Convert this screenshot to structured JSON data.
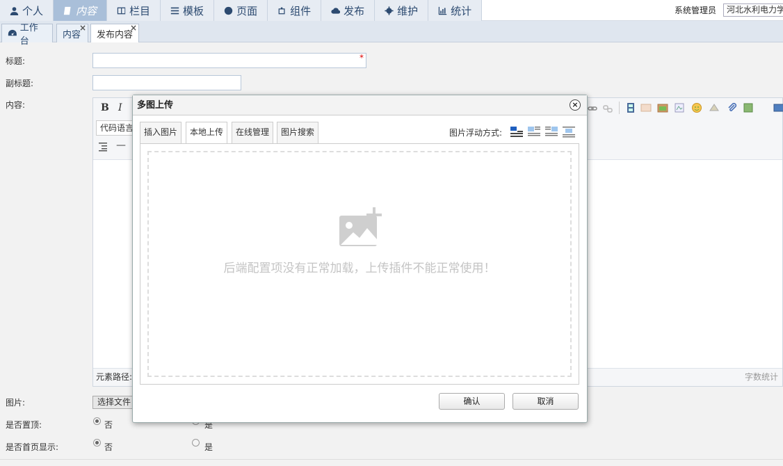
{
  "topnav": {
    "menu": [
      {
        "label": "个人",
        "icon": "person-icon"
      },
      {
        "label": "内容",
        "icon": "book-icon"
      },
      {
        "label": "栏目",
        "icon": "columns-icon"
      },
      {
        "label": "模板",
        "icon": "list-icon"
      },
      {
        "label": "页面",
        "icon": "globe-icon"
      },
      {
        "label": "组件",
        "icon": "puzzle-icon"
      },
      {
        "label": "发布",
        "icon": "cloud-upload-icon"
      },
      {
        "label": "维护",
        "icon": "gear-icon"
      },
      {
        "label": "统计",
        "icon": "bar-chart-icon"
      }
    ],
    "active_index": 1,
    "user_label": "系统管理员",
    "site_value": "河北水利电力学"
  },
  "tabs": [
    {
      "label": "工作台",
      "icon": "dashboard-icon",
      "closable": false
    },
    {
      "label": "内容",
      "closable": true
    },
    {
      "label": "发布内容",
      "closable": true
    }
  ],
  "tab_close_glyph": "×",
  "form": {
    "title_label": "标题:",
    "subtitle_label": "副标题:",
    "content_label": "内容:",
    "image_label": "图片:",
    "top_label": "是否置顶:",
    "home_label": "是否首页显示:",
    "required_mark": "*",
    "choose_file": "选择文件",
    "no_label": "否",
    "yes_label": "是"
  },
  "editor": {
    "bold": "B",
    "italic": "I",
    "code_lang": "代码语言",
    "hr_glyph": "—",
    "element_path": "元素路径:",
    "word_count": "字数统计"
  },
  "dialog": {
    "title": "多图上传",
    "close_glyph": "×",
    "tabs": [
      "插入图片",
      "本地上传",
      "在线管理",
      "图片搜索"
    ],
    "active_tab": 1,
    "float_label": "图片浮动方式:",
    "message": "后端配置项没有正常加载，上传插件不能正常使用！",
    "confirm": "确认",
    "cancel": "取消"
  },
  "colors": {
    "accent": "#a9bfd9",
    "nav_text": "#2c4a70",
    "required": "#dd0000"
  }
}
